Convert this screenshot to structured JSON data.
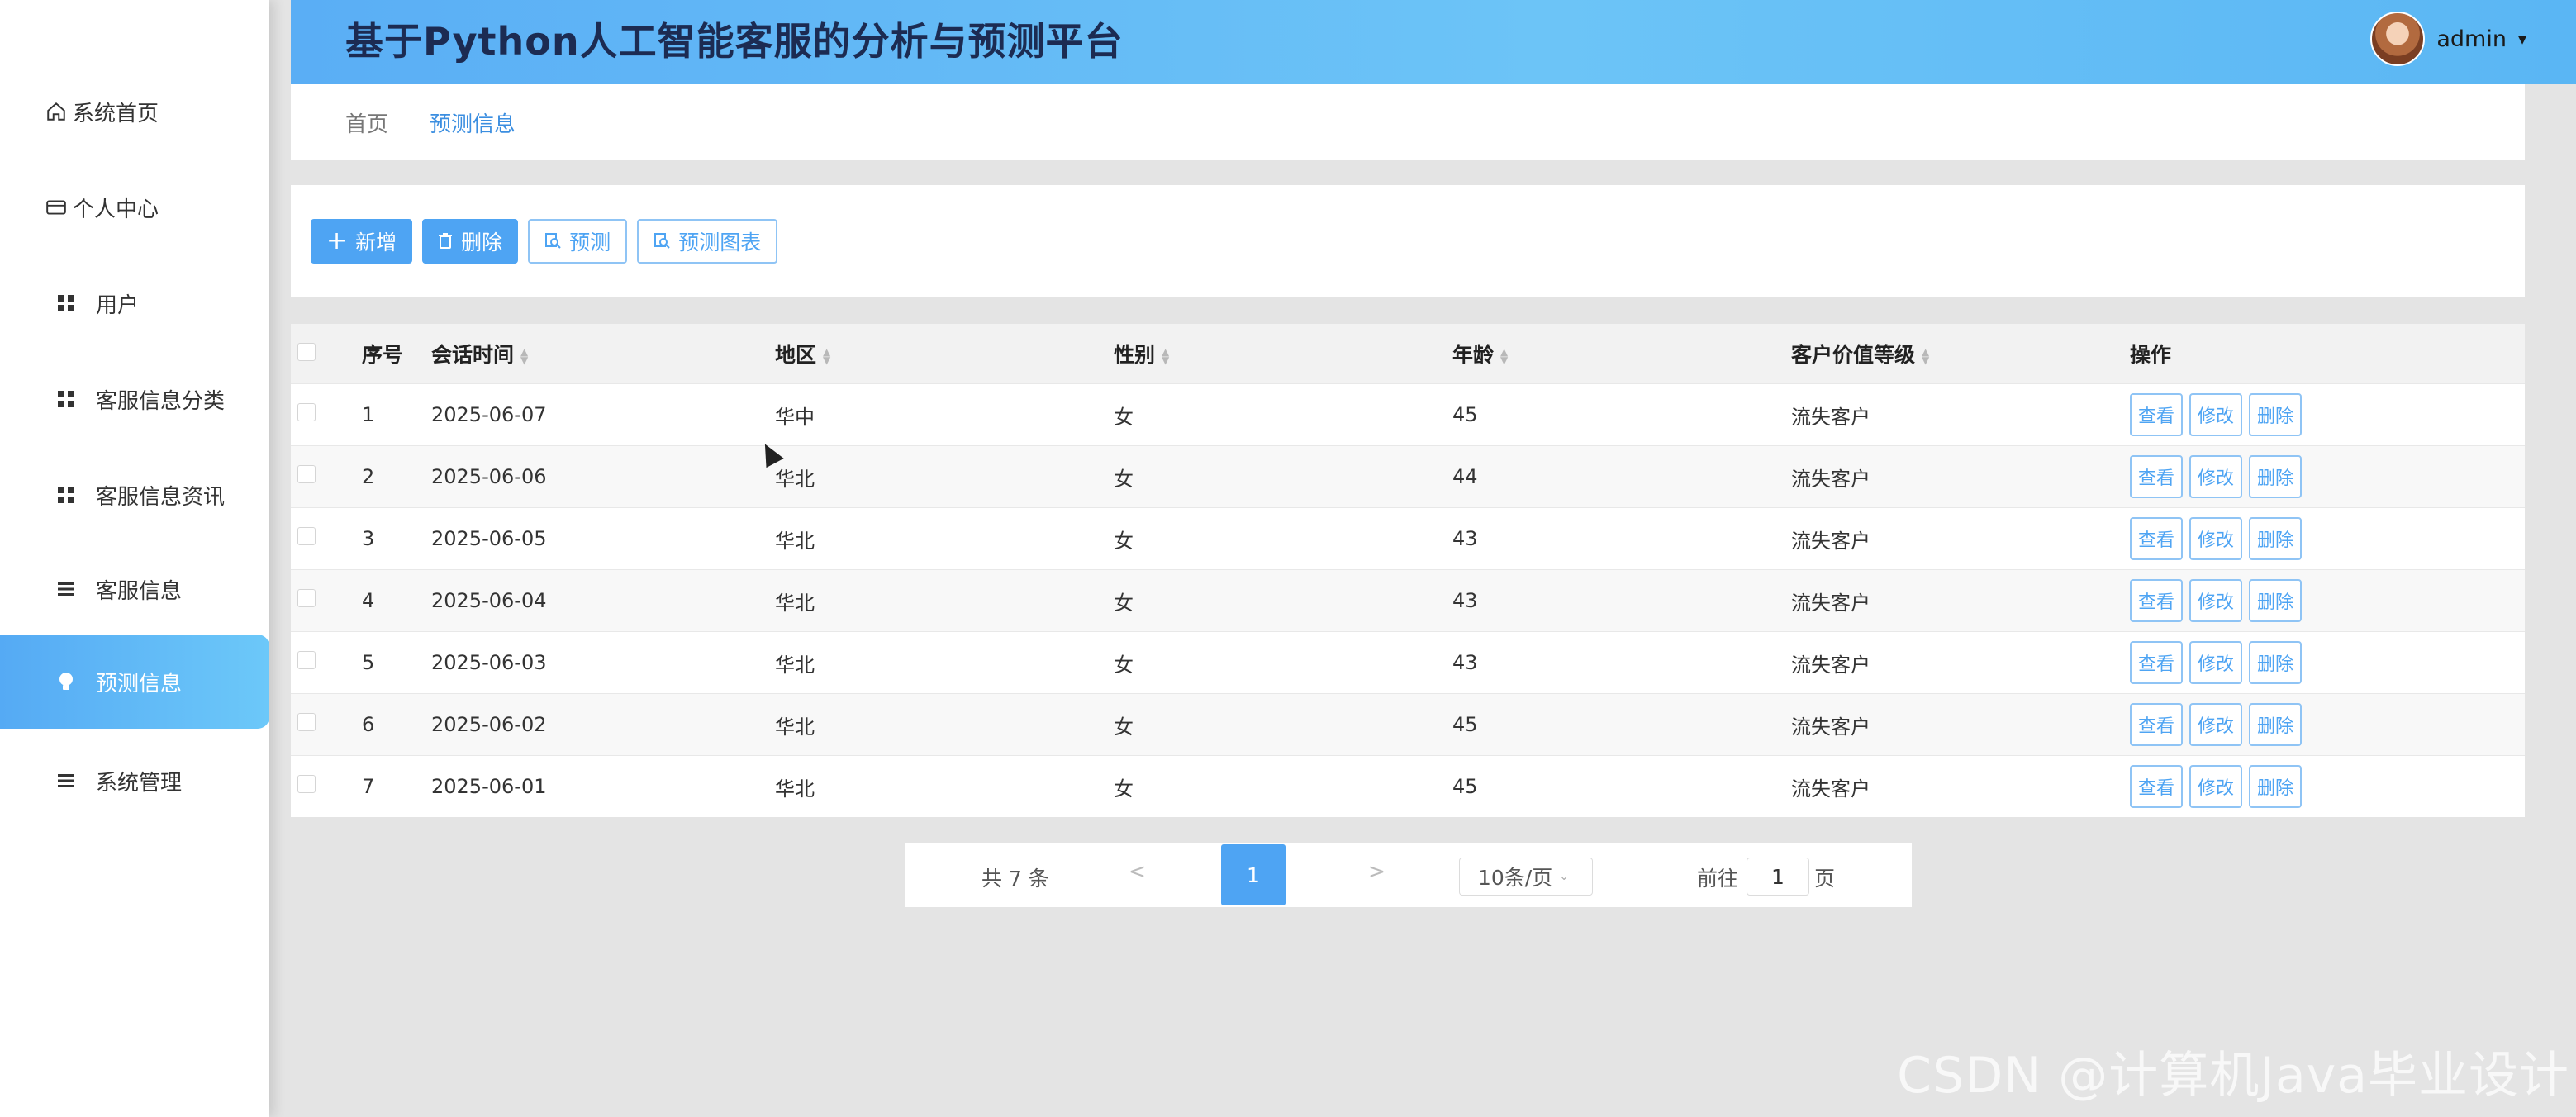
{
  "header": {
    "title": "基于Python人工智能客服的分析与预测平台",
    "username": "admin",
    "caret": "▾"
  },
  "sidebar": {
    "items": [
      {
        "label": "系统首页",
        "icon": "home-icon"
      },
      {
        "label": "个人中心",
        "icon": "card-icon"
      },
      {
        "label": "用户",
        "icon": "grid-icon"
      },
      {
        "label": "客服信息分类",
        "icon": "grid-icon"
      },
      {
        "label": "客服信息资讯",
        "icon": "grid-icon"
      },
      {
        "label": "客服信息",
        "icon": "list-icon"
      },
      {
        "label": "预测信息",
        "icon": "bulb-icon",
        "active": true
      },
      {
        "label": "系统管理",
        "icon": "list-icon"
      }
    ]
  },
  "breadcrumb": {
    "home": "首页",
    "current": "预测信息"
  },
  "toolbar": {
    "add_label": "新增",
    "delete_label": "删除",
    "predict_label": "预测",
    "chart_label": "预测图表"
  },
  "table": {
    "headers": {
      "seq": "序号",
      "time": "会话时间",
      "region": "地区",
      "sex": "性别",
      "age": "年龄",
      "level": "客户价值等级",
      "ops": "操作"
    },
    "ops": {
      "view": "查看",
      "edit": "修改",
      "delete": "删除"
    },
    "rows": [
      {
        "seq": "1",
        "time": "2025-06-07",
        "region": "华中",
        "sex": "女",
        "age": "45",
        "level": "流失客户"
      },
      {
        "seq": "2",
        "time": "2025-06-06",
        "region": "华北",
        "sex": "女",
        "age": "44",
        "level": "流失客户"
      },
      {
        "seq": "3",
        "time": "2025-06-05",
        "region": "华北",
        "sex": "女",
        "age": "43",
        "level": "流失客户"
      },
      {
        "seq": "4",
        "time": "2025-06-04",
        "region": "华北",
        "sex": "女",
        "age": "43",
        "level": "流失客户"
      },
      {
        "seq": "5",
        "time": "2025-06-03",
        "region": "华北",
        "sex": "女",
        "age": "43",
        "level": "流失客户"
      },
      {
        "seq": "6",
        "time": "2025-06-02",
        "region": "华北",
        "sex": "女",
        "age": "45",
        "level": "流失客户"
      },
      {
        "seq": "7",
        "time": "2025-06-01",
        "region": "华北",
        "sex": "女",
        "age": "45",
        "level": "流失客户"
      }
    ]
  },
  "pagination": {
    "total": "共 7 条",
    "prev": "<",
    "current_page": "1",
    "next": ">",
    "page_size": "10条/页",
    "goto_label": "前往",
    "goto_value": "1",
    "page_unit": "页"
  },
  "watermark": "CSDN @计算机Java毕业设计",
  "colors": {
    "accent": "#4ea4f3",
    "header_gradient_start": "#5aaef5",
    "header_gradient_end": "#6cc4f7",
    "title_text": "#1c2b52"
  }
}
